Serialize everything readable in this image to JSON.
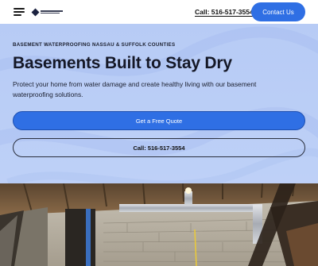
{
  "header": {
    "phone_label": "Call: 516-517-3554",
    "contact_label": "Contact Us"
  },
  "hero": {
    "eyebrow": "BASEMENT WATERPROOFING NASSAU & SUFFOLK COUNTIES",
    "headline": "Basements Built to Stay Dry",
    "subtext": "Protect your home from water damage and create healthy living with our basement waterproofing solutions.",
    "quote_button": "Get a Free Quote",
    "call_button": "Call: 516-517-3554"
  },
  "colors": {
    "accent": "#2f6fe4",
    "hero_bg": "#b9cdf6",
    "text_dark": "#151827"
  },
  "icons": {
    "menu": "hamburger-menu-icon",
    "logo": "company-logo"
  }
}
